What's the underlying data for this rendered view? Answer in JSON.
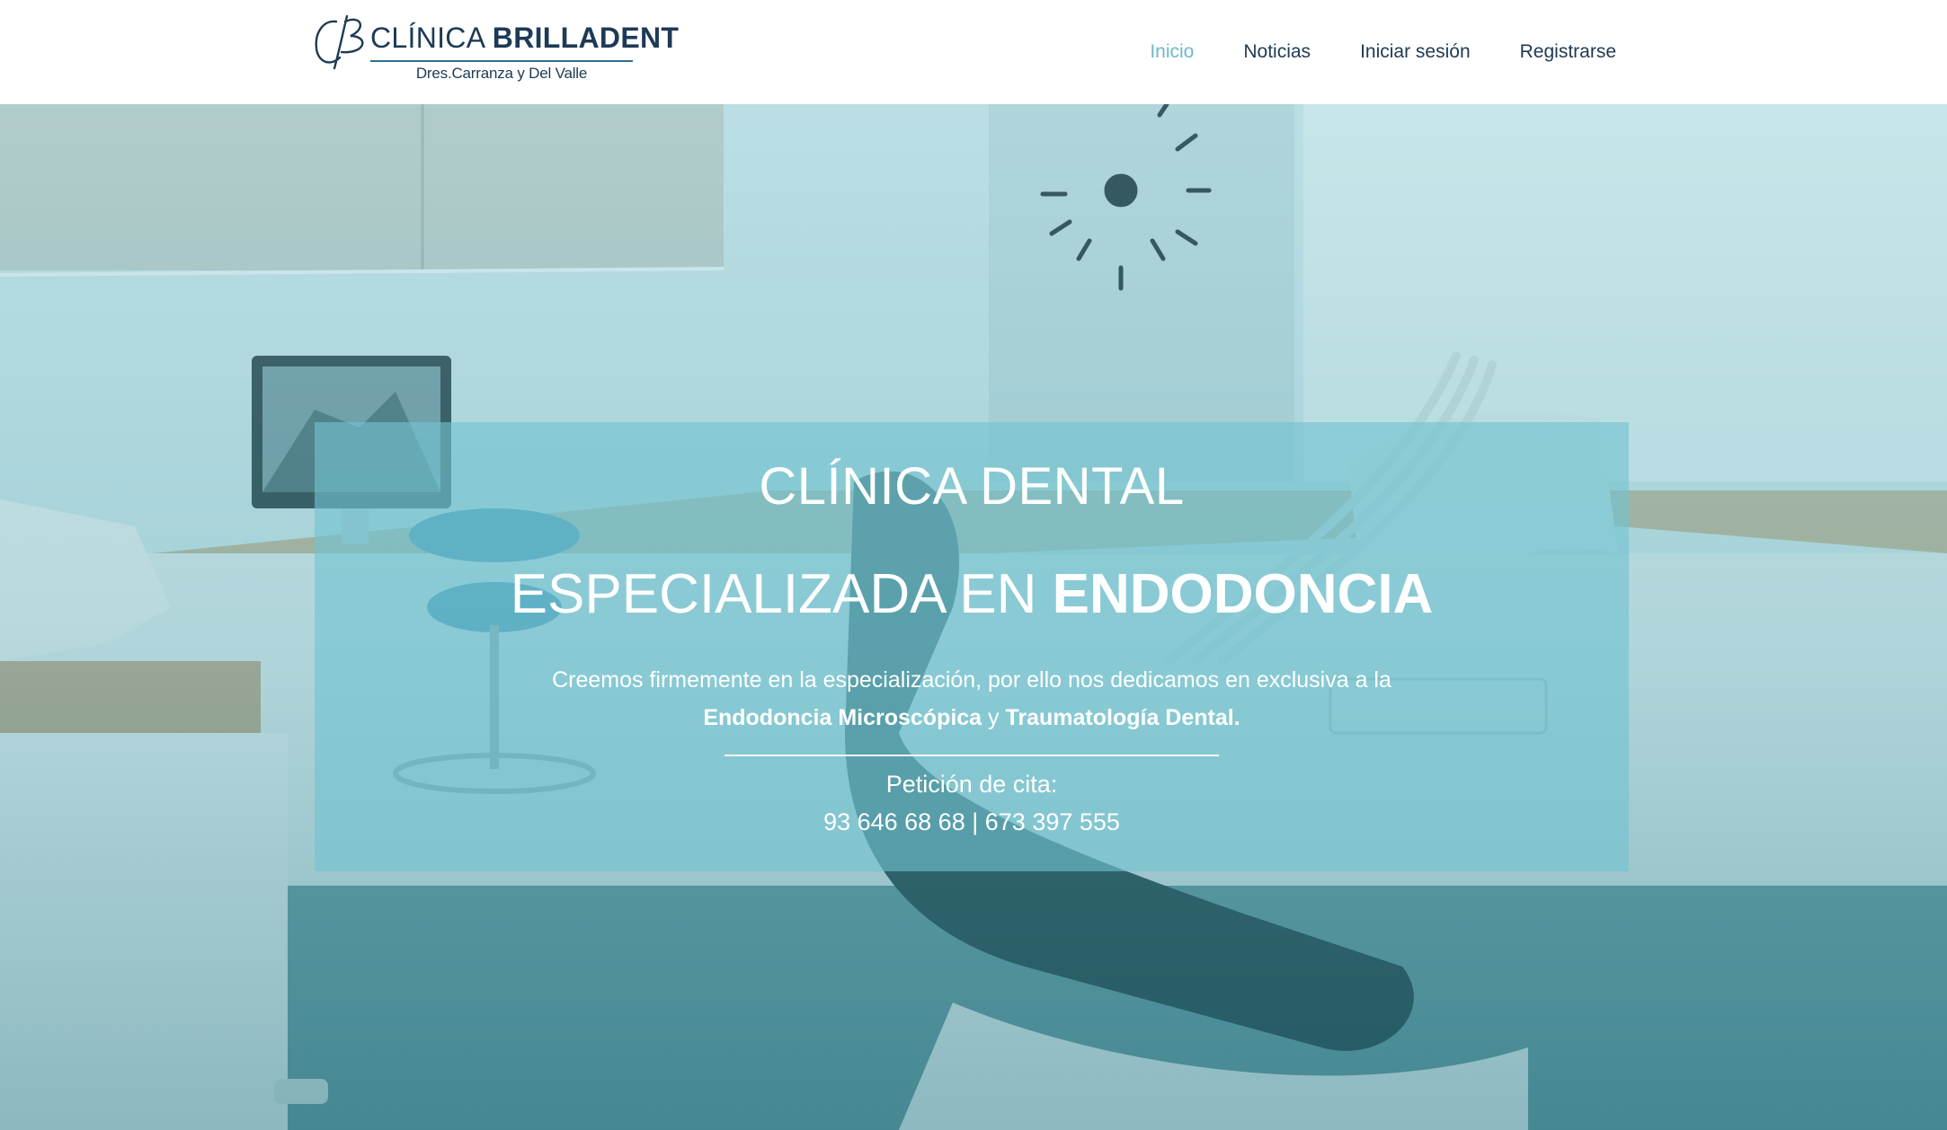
{
  "header": {
    "logo": {
      "monogram": "CB",
      "name_light": "CLÍNICA",
      "name_bold": "BRILLADENT",
      "subtitle": "Dres.Carranza y Del Valle"
    },
    "nav": {
      "items": [
        {
          "label": "Inicio",
          "active": true
        },
        {
          "label": "Noticias",
          "active": false
        },
        {
          "label": "Iniciar sesión",
          "active": false
        },
        {
          "label": "Registrarse",
          "active": false
        }
      ]
    }
  },
  "hero": {
    "title": "CLÍNICA DENTAL",
    "subtitle_light": "ESPECIALIZADA EN",
    "subtitle_bold": "ENDODONCIA",
    "text_line1": "Creemos firmemente en la especialización, por ello nos dedicamos en exclusiva a la",
    "text_bold1": "Endodoncia Microscópica",
    "text_connector": "y",
    "text_bold2": "Traumatología Dental.",
    "cita_label": "Petición de cita:",
    "phone1": "93 646 68 68",
    "phone_separator": "|",
    "phone2": "673 397 555",
    "background_image": "dental-office-photo",
    "overlay_color": "#71c4d0"
  },
  "colors": {
    "brand_dark": "#1d3a56",
    "nav_active": "#6fb8c9",
    "nav_text": "#1e3a52",
    "panel_bg": "#71c4d0"
  }
}
